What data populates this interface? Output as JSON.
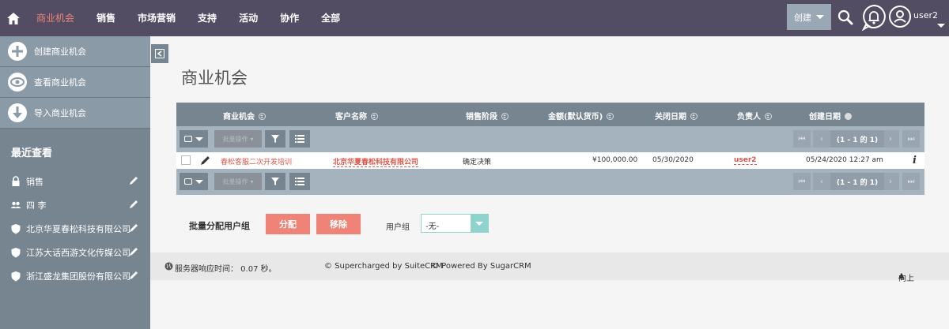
{
  "nav": {
    "items": [
      {
        "label": "商业机会",
        "active": true
      },
      {
        "label": "销售"
      },
      {
        "label": "市场营销"
      },
      {
        "label": "支持"
      },
      {
        "label": "活动"
      },
      {
        "label": "协作"
      },
      {
        "label": "全部"
      }
    ],
    "create_label": "创建",
    "user_label": "user2"
  },
  "sidebar": {
    "actions": [
      {
        "label": "创建商业机会",
        "icon": "plus-icon"
      },
      {
        "label": "查看商业机会",
        "icon": "eye-icon"
      },
      {
        "label": "导入商业机会",
        "icon": "download-icon"
      }
    ],
    "recent_title": "最近查看",
    "recent": [
      {
        "label": "销售",
        "icon": "lock-icon"
      },
      {
        "label": "四 李",
        "icon": "users-icon"
      },
      {
        "label": "北京华夏春松科技有限公司",
        "icon": "shield-icon"
      },
      {
        "label": "江苏大话西游文化传媒公司",
        "icon": "shield-icon"
      },
      {
        "label": "浙江盛龙集团股份有限公司",
        "icon": "shield-icon"
      }
    ]
  },
  "main": {
    "title": "商业机会",
    "columns": [
      "商业机会",
      "客户名称",
      "销售阶段",
      "金额(默认货币)",
      "关闭日期",
      "负责人",
      "创建日期"
    ],
    "bulk_action_label": "批量操作",
    "pagination": "(1 - 1 的 1)",
    "rows": [
      {
        "name": "春松客服二次开发培训",
        "account": "北京华夏春松科技有限公司",
        "stage": "确定决策",
        "amount": "¥100,000.00",
        "close_date": "05/30/2020",
        "assigned": "user2",
        "created": "05/24/2020 12:27 am"
      }
    ],
    "mass_assign_label": "批量分配用户组",
    "assign_button": "分配",
    "remove_button": "移除",
    "user_group_label": "用户组",
    "user_group_value": "-无-"
  },
  "footer": {
    "response_time": "服务器响应时间：  0.07 秒。",
    "suitecrm": "© Supercharged by SuiteCRM",
    "sugarcrm": "© Powered By SugarCRM",
    "back_to_top": "向上"
  },
  "colors": {
    "topbar": "#534d64",
    "accent": "#f08377",
    "sidebar": "#778591"
  }
}
